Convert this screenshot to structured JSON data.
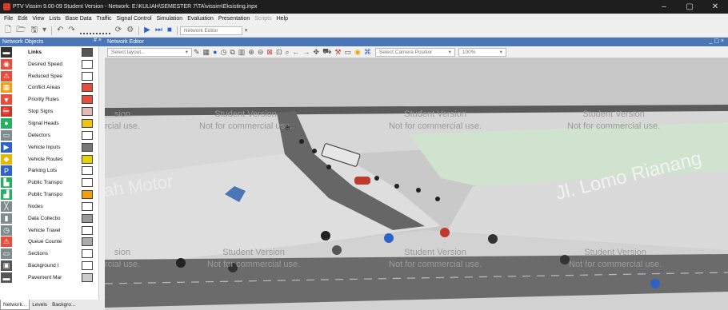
{
  "window": {
    "title": "PTV Vissim 9.00-09 Student Version - Network: E:\\KULIAH\\SEMESTER 7\\TA\\vissim\\Eksisting.inpx",
    "minimize": "–",
    "maximize": "▢",
    "close": "✕"
  },
  "menu": [
    {
      "label": "File"
    },
    {
      "label": "Edit"
    },
    {
      "label": "View"
    },
    {
      "label": "Lists"
    },
    {
      "label": "Base Data"
    },
    {
      "label": "Traffic"
    },
    {
      "label": "Signal Control"
    },
    {
      "label": "Simulation"
    },
    {
      "label": "Evaluation"
    },
    {
      "label": "Presentation"
    },
    {
      "label": "Scripts",
      "disabled": true
    },
    {
      "label": "Help"
    }
  ],
  "toolbar": {
    "network_editor_label": "Network Editor"
  },
  "network_objects": {
    "title": "Network Objects",
    "controls": "# ×",
    "items": [
      {
        "label": "Links",
        "icon": "links-icon",
        "color": "#333333",
        "bold": true
      },
      {
        "label": "Desired Speed",
        "icon": "desired-speed-icon",
        "color": "#e74c3c"
      },
      {
        "label": "Reduced Spee",
        "icon": "reduced-speed-icon",
        "color": "#e74c3c"
      },
      {
        "label": "Conflict Areas",
        "icon": "conflict-areas-icon",
        "color": "#f39c12"
      },
      {
        "label": "Priority Rules",
        "icon": "priority-rules-icon",
        "color": "#e74c3c"
      },
      {
        "label": "Stop Signs",
        "icon": "stop-signs-icon",
        "color": "#c0392b"
      },
      {
        "label": "Signal Heads",
        "icon": "signal-heads-icon",
        "color": "#27ae60"
      },
      {
        "label": "Detectors",
        "icon": "detectors-icon",
        "color": "#7f8c8d"
      },
      {
        "label": "Vehicle Inputs",
        "icon": "vehicle-inputs-icon",
        "color": "#2f62c8"
      },
      {
        "label": "Vehicle Routes",
        "icon": "vehicle-routes-icon",
        "color": "#e6b800"
      },
      {
        "label": "Parking Lots",
        "icon": "parking-lots-icon",
        "color": "#2f62c8"
      },
      {
        "label": "Public Transpo",
        "icon": "public-transport-stops-icon",
        "color": "#27ae60"
      },
      {
        "label": "Public Transpo",
        "icon": "public-transport-lines-icon",
        "color": "#27ae60"
      },
      {
        "label": "Nodes",
        "icon": "nodes-icon",
        "color": "#7f8c8d"
      },
      {
        "label": "Data Collectio",
        "icon": "data-collection-icon",
        "color": "#7f8c8d"
      },
      {
        "label": "Vehicle Travel",
        "icon": "vehicle-travel-icon",
        "color": "#7f8c8d"
      },
      {
        "label": "Queue Counte",
        "icon": "queue-counters-icon",
        "color": "#e74c3c"
      },
      {
        "label": "Sections",
        "icon": "sections-icon",
        "color": "#7f8c8d"
      },
      {
        "label": "Background I",
        "icon": "background-images-icon",
        "color": "#555555"
      },
      {
        "label": "Pavement Mar",
        "icon": "pavement-markings-icon",
        "color": "#555555"
      }
    ]
  },
  "bottom_tabs": [
    {
      "label": "Network..."
    },
    {
      "label": "Levels"
    },
    {
      "label": "Backgro..."
    }
  ],
  "editor": {
    "title": "Network Editor",
    "controls": "_ ▢ ×",
    "layout_placeholder": "Select layout...",
    "camera_label": "Select Camera Positior",
    "zoom": "100%"
  },
  "canvas": {
    "watermarks": [
      {
        "line1": "Student Version",
        "line2": "Not for commercial use."
      }
    ],
    "wm_fragment_left": "sion",
    "wm_fragment_left2": "rcial use.",
    "road_labels": [
      {
        "text": "Jl. Lomo Rianang"
      },
      {
        "text": "ah Motor"
      }
    ]
  }
}
